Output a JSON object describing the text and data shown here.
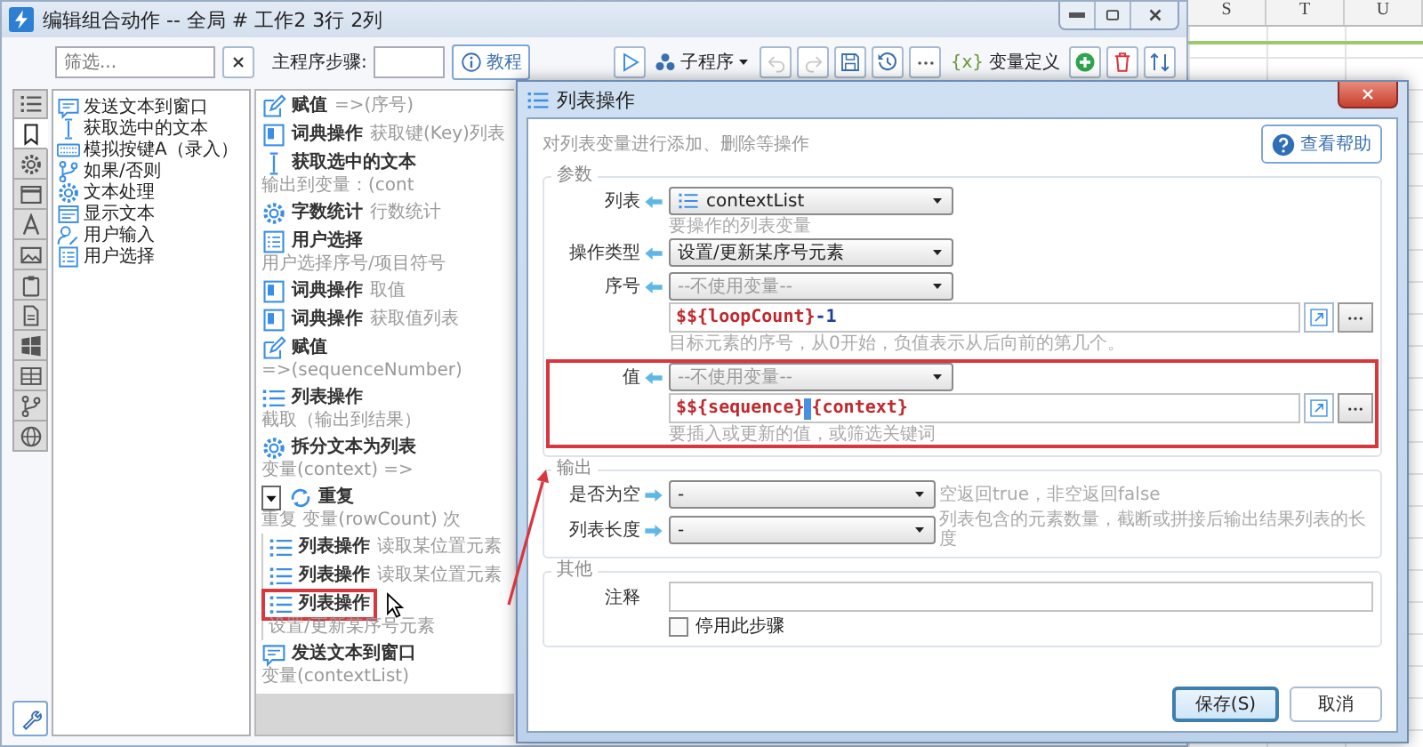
{
  "window": {
    "title": "编辑组合动作 -- 全局 # 工作2 3行 2列"
  },
  "spreadsheet": {
    "columns": [
      "S",
      "T",
      "U"
    ]
  },
  "filter": {
    "placeholder": "筛选..."
  },
  "steps_header": {
    "label": "主程序步骤:",
    "tutorial_button": "教程"
  },
  "toolbar": {
    "subprogram": "子程序",
    "undo": {
      "disabled": true
    },
    "redo": {
      "disabled": true
    },
    "variables_icon": "{x}",
    "variables": "变量定义"
  },
  "category_tabs": [
    {
      "kind": "list",
      "selected": false
    },
    {
      "kind": "bookmark",
      "selected": true
    },
    {
      "kind": "gear",
      "selected": false
    },
    {
      "kind": "window",
      "selected": false
    },
    {
      "kind": "font",
      "selected": false
    },
    {
      "kind": "image",
      "selected": false
    },
    {
      "kind": "clipboard",
      "selected": false
    },
    {
      "kind": "document",
      "selected": false
    },
    {
      "kind": "windows",
      "selected": false
    },
    {
      "kind": "grid",
      "selected": false
    },
    {
      "kind": "branch",
      "selected": false
    },
    {
      "kind": "globe",
      "selected": false
    }
  ],
  "actions": [
    {
      "kind": "message",
      "label": "发送文本到窗口"
    },
    {
      "kind": "cursor",
      "label": "获取选中的文本"
    },
    {
      "kind": "keyboard",
      "label": "模拟按键A（录入）"
    },
    {
      "kind": "branch",
      "label": "如果/否则"
    },
    {
      "kind": "gear",
      "label": "文本处理"
    },
    {
      "kind": "display",
      "label": "显示文本"
    },
    {
      "kind": "user",
      "label": "用户输入"
    },
    {
      "kind": "checklist",
      "label": "用户选择"
    }
  ],
  "steps": [
    {
      "kind": "edit",
      "name": "赋值",
      "detail": "=>(序号)"
    },
    {
      "kind": "dict",
      "name": "词典操作",
      "detail": "获取键(Key)列表"
    },
    {
      "kind": "cursor",
      "name": "获取选中的文本",
      "detail": "输出到变量：(cont"
    },
    {
      "kind": "gear",
      "name": "字数统计",
      "detail": "行数统计"
    },
    {
      "kind": "checklist",
      "name": "用户选择",
      "detail": "用户选择序号/项目符号"
    },
    {
      "kind": "dict",
      "name": "词典操作",
      "detail": "取值"
    },
    {
      "kind": "dict",
      "name": "词典操作",
      "detail": "获取值列表"
    },
    {
      "kind": "edit",
      "name": "赋值",
      "detail": "=>(sequenceNumber)"
    },
    {
      "kind": "list",
      "name": "列表操作",
      "detail": "截取（输出到结果）"
    },
    {
      "kind": "gear",
      "name": "拆分文本为列表",
      "detail": "变量(context) =>"
    },
    {
      "kind": "repeat",
      "name": "重复",
      "detail": "重复 变量(rowCount) 次",
      "expanded": true,
      "children": [
        {
          "kind": "list",
          "name": "列表操作",
          "detail": "读取某位置元素",
          "highlighted": false
        },
        {
          "kind": "list",
          "name": "列表操作",
          "detail": "读取某位置元素",
          "highlighted": false
        },
        {
          "kind": "list",
          "name": "列表操作",
          "detail": "设置/更新某序号元素",
          "highlighted": true
        }
      ]
    },
    {
      "kind": "message",
      "name": "发送文本到窗口",
      "detail": "变量(contextList)"
    }
  ],
  "dialog": {
    "title": "列表操作",
    "description": "对列表变量进行添加、删除等操作",
    "help_button": "查看帮助",
    "groups": [
      {
        "kind": "input",
        "title": "参数",
        "rows": [
          {
            "kind": "variable-select",
            "label": "列表",
            "value": "contextList",
            "hint": "要操作的列表变量"
          },
          {
            "kind": "select",
            "label": "操作类型",
            "value": "设置/更新某序号元素"
          },
          {
            "kind": "select-expression",
            "label": "序号",
            "placeholder": "--不使用变量--",
            "expression": [
              {
                "kind": "variable",
                "text": "$${loopCount}"
              },
              {
                "kind": "literal",
                "text": "-1"
              }
            ],
            "hint": "目标元素的序号，从0开始，负值表示从后向前的第几个。",
            "highlighted": false
          },
          {
            "kind": "select-expression",
            "label": "值",
            "placeholder": "--不使用变量--",
            "expression": [
              {
                "kind": "variable",
                "text": "$${sequence}"
              },
              {
                "kind": "caret"
              },
              {
                "kind": "variable",
                "text": "{context}"
              }
            ],
            "hint": "要插入或更新的值，或筛选关键词",
            "highlighted": true
          }
        ]
      },
      {
        "kind": "output",
        "title": "输出",
        "rows": [
          {
            "kind": "select",
            "label": "是否为空",
            "value": "-",
            "hint": "空返回true，非空返回false"
          },
          {
            "kind": "select",
            "label": "列表长度",
            "value": "-",
            "hint": "列表包含的元素数量，截断或拼接后输出结果列表的长度"
          }
        ]
      },
      {
        "kind": "other",
        "title": "其他",
        "comment_label": "注释",
        "disable_step": {
          "label": "停用此步骤",
          "checked": false
        }
      }
    ],
    "buttons": [
      {
        "label": "保存(S)",
        "default": true
      },
      {
        "label": "取消",
        "default": false
      }
    ]
  }
}
